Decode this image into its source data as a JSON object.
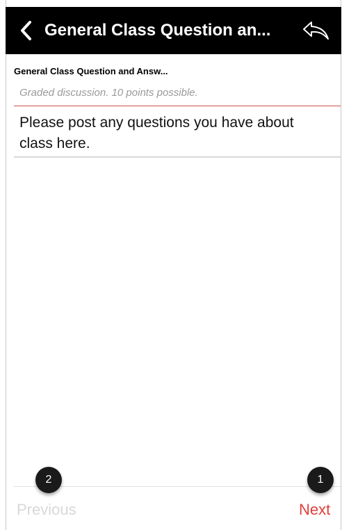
{
  "navbar": {
    "back_icon": "chevron-left-icon",
    "title": "General Class Question an...",
    "reply_icon": "reply-arrow-icon",
    "background": "#000000"
  },
  "discussion": {
    "title": "General Class Question and Answ...",
    "subtitle": "Graded discussion. 10 points possible.",
    "message": "Please post any questions you have about class here."
  },
  "pagination": {
    "previous_label": "Previous",
    "next_label": "Next",
    "next_color": "#e0403a"
  },
  "markers": {
    "previous_number": "2",
    "next_number": "1"
  }
}
